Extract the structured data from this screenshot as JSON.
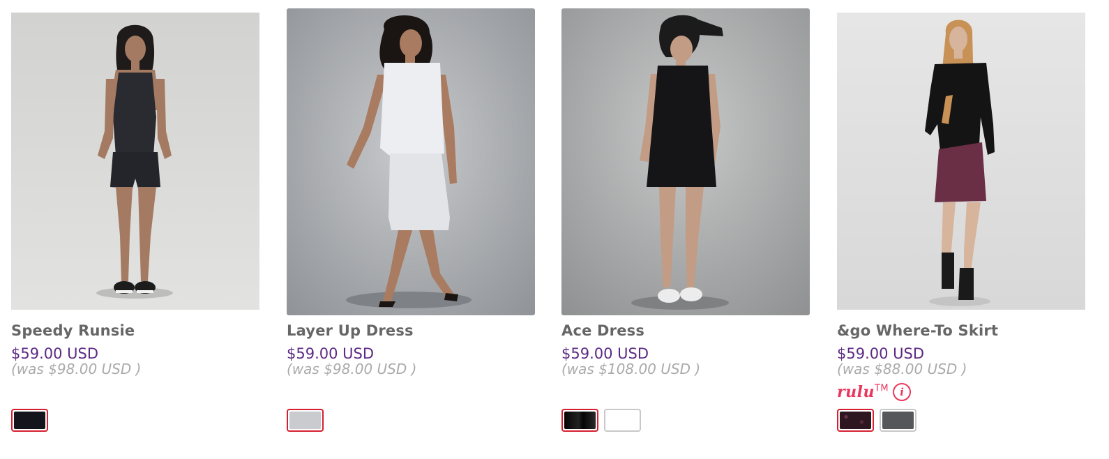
{
  "products": [
    {
      "name": "Speedy Runsie",
      "price": "$59.00 USD",
      "was": "(was $98.00 USD )",
      "swatches": [
        {
          "color": "#14151c",
          "selected": true
        }
      ]
    },
    {
      "name": "Layer Up Dress",
      "price": "$59.00 USD",
      "was": "(was $98.00 USD )",
      "swatches": [
        {
          "color": "#c9cbce",
          "selected": true
        }
      ]
    },
    {
      "name": "Ace Dress",
      "price": "$59.00 USD",
      "was": "(was $108.00 USD )",
      "swatches": [
        {
          "color": "#0b0b0d",
          "selected": true
        },
        {
          "color": "#ffffff",
          "selected": false
        }
      ]
    },
    {
      "name": "&go Where-To Skirt",
      "price": "$59.00 USD",
      "was": "(was $88.00 USD )",
      "badge": {
        "text": "rulu",
        "tm": "TM",
        "icon": "info-icon"
      },
      "swatches": [
        {
          "color": "#3a1c28",
          "selected": true
        },
        {
          "color": "#56575b",
          "selected": false
        }
      ]
    }
  ],
  "colors": {
    "price": "#5d2a83",
    "name": "#666666",
    "was": "#aaaaaa",
    "badge": "#e8365d",
    "selected_swatch_border": "#d6202f"
  }
}
